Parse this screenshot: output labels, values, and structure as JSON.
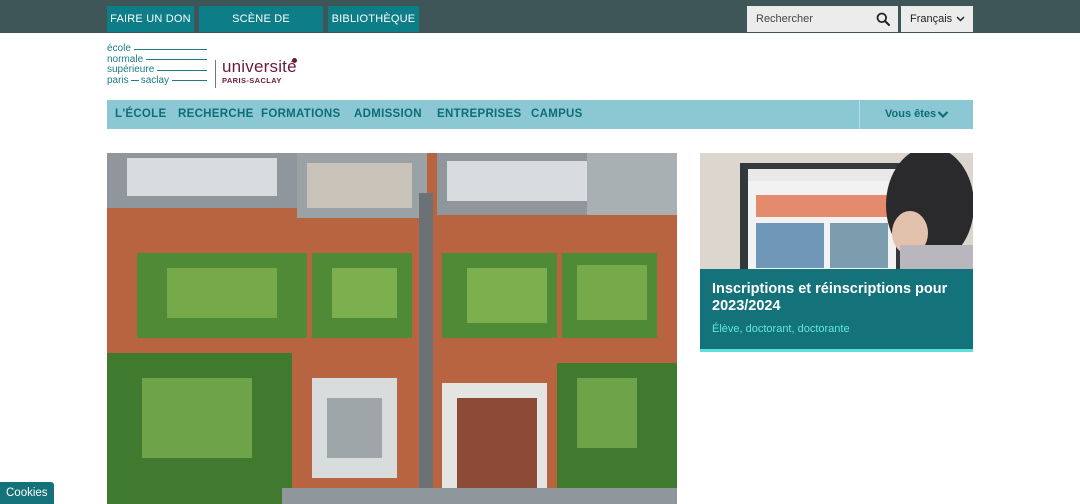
{
  "topbar": {
    "buttons": [
      "FAIRE UN DON",
      "SCÈNE DE RECHERCHE",
      "BIBLIOTHÈQUE"
    ],
    "search_placeholder": "Rechercher",
    "language": "Français"
  },
  "logos": {
    "ens_lines": [
      "école",
      "normale",
      "supérieure",
      "paris",
      "saclay"
    ],
    "university_line1": "université",
    "university_line2": "PARIS-SACLAY"
  },
  "nav": {
    "items": [
      "L'ÉCOLE",
      "RECHERCHE",
      "FORMATIONS",
      "ADMISSION",
      "ENTREPRISES",
      "CAMPUS"
    ],
    "audience_label": "Vous êtes"
  },
  "card": {
    "title": "Inscriptions et réinscriptions pour 2023/2024",
    "subtitle": "Élève, doctorant, doctorante"
  },
  "cookies_label": "Cookies",
  "colors": {
    "topbar_bg": "#3f5658",
    "accent_teal": "#0d7e88",
    "nav_bg": "#8cc8d4",
    "nav_text": "#0c6e78",
    "card_panel": "#14727a",
    "card_subtitle": "#62e8d8",
    "university_color": "#6b1a3b"
  },
  "icons": [
    "search-icon",
    "chevron-down-icon"
  ]
}
